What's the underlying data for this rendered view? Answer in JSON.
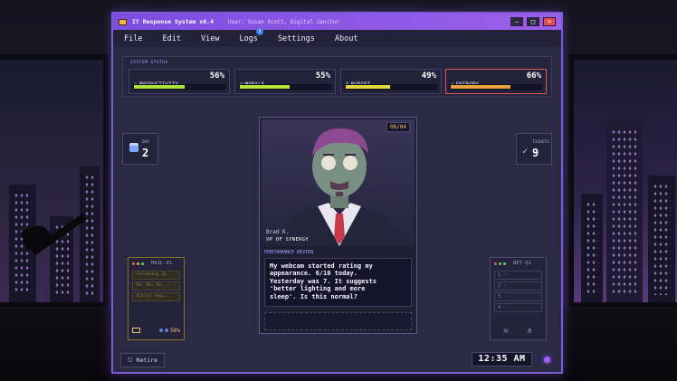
{
  "window": {
    "title": "IT Response System v8.4",
    "user": "User: Susan Scott, Digital Janitor"
  },
  "menu": [
    "File",
    "Edit",
    "View",
    "Logs",
    "Settings",
    "About"
  ],
  "logs_badge": "1",
  "status": {
    "title": "SYSTEM STATUS",
    "meters": [
      {
        "label": "PRODUCTIVITY",
        "value": "56%",
        "fraction": 0.56,
        "color": "#a8e23a",
        "icon": "✣"
      },
      {
        "label": "MORALE",
        "value": "55%",
        "fraction": 0.55,
        "color": "#b7e23a",
        "icon": "☺"
      },
      {
        "label": "BUDGET",
        "value": "49%",
        "fraction": 0.49,
        "color": "#e7d63a",
        "icon": "$"
      },
      {
        "label": "ENTROPY",
        "value": "66%",
        "fraction": 0.66,
        "color": "#e8a43a",
        "icon": "⚡"
      }
    ]
  },
  "day": {
    "label": "DAY",
    "value": "2"
  },
  "tickets": {
    "label": "TICKETS",
    "value": "9"
  },
  "card": {
    "counter": "06/04",
    "name": "Brad K.",
    "role": "VP OF SYNERGY",
    "review_label": "PERFORMANCE REVIEW",
    "message": "My webcam started rating my\nappearance. 6/10 today.\nYesterday was 7. It suggests\n'better lighting and more\nsleep'. Is this normal?"
  },
  "mail": {
    "title": "MAIL-01",
    "rows": [
      "Following up...",
      "Re: Re: Re:...",
      "Action requ..."
    ],
    "percent": "56%"
  },
  "net": {
    "title": "NET-01",
    "rows": [
      "1 -",
      "2 -",
      "3 -",
      "4 -"
    ]
  },
  "retire_label": "Retire",
  "clock": "12:35 AM"
}
